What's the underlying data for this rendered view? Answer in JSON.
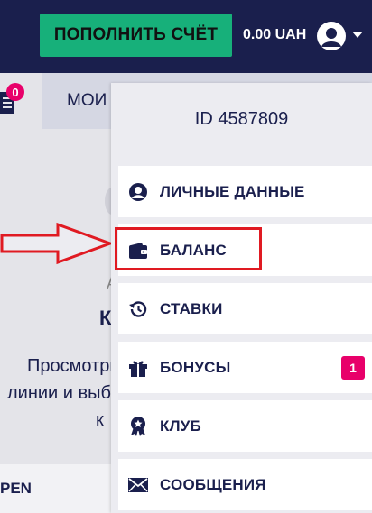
{
  "header": {
    "deposit_label": "ПОПОЛНИТЬ СЧЁТ",
    "balance": "0.00 UAH"
  },
  "subbar": {
    "ticket_count": "0",
    "tab_label": "МОИ С"
  },
  "background": {
    "heading_char": "К",
    "line1": "Просмотри",
    "line2": "линии и выб",
    "line3": "к",
    "bottom_label": "PEN",
    "small_char": "А"
  },
  "profile_menu": {
    "user_id": "ID 4587809",
    "items": [
      {
        "label": "ЛИЧНЫЕ ДАННЫЕ",
        "icon": "user-icon"
      },
      {
        "label": "БАЛАНС",
        "icon": "wallet-icon"
      },
      {
        "label": "СТАВКИ",
        "icon": "history-icon"
      },
      {
        "label": "БОНУСЫ",
        "icon": "gift-icon",
        "badge": "1"
      },
      {
        "label": "КЛУБ",
        "icon": "award-icon"
      },
      {
        "label": "СООБЩЕНИЯ",
        "icon": "envelope-icon"
      }
    ]
  },
  "colors": {
    "header_bg": "#1a1f4d",
    "deposit_green": "#17b07a",
    "badge_pink": "#e8006a",
    "annotation_red": "#e01a22"
  }
}
